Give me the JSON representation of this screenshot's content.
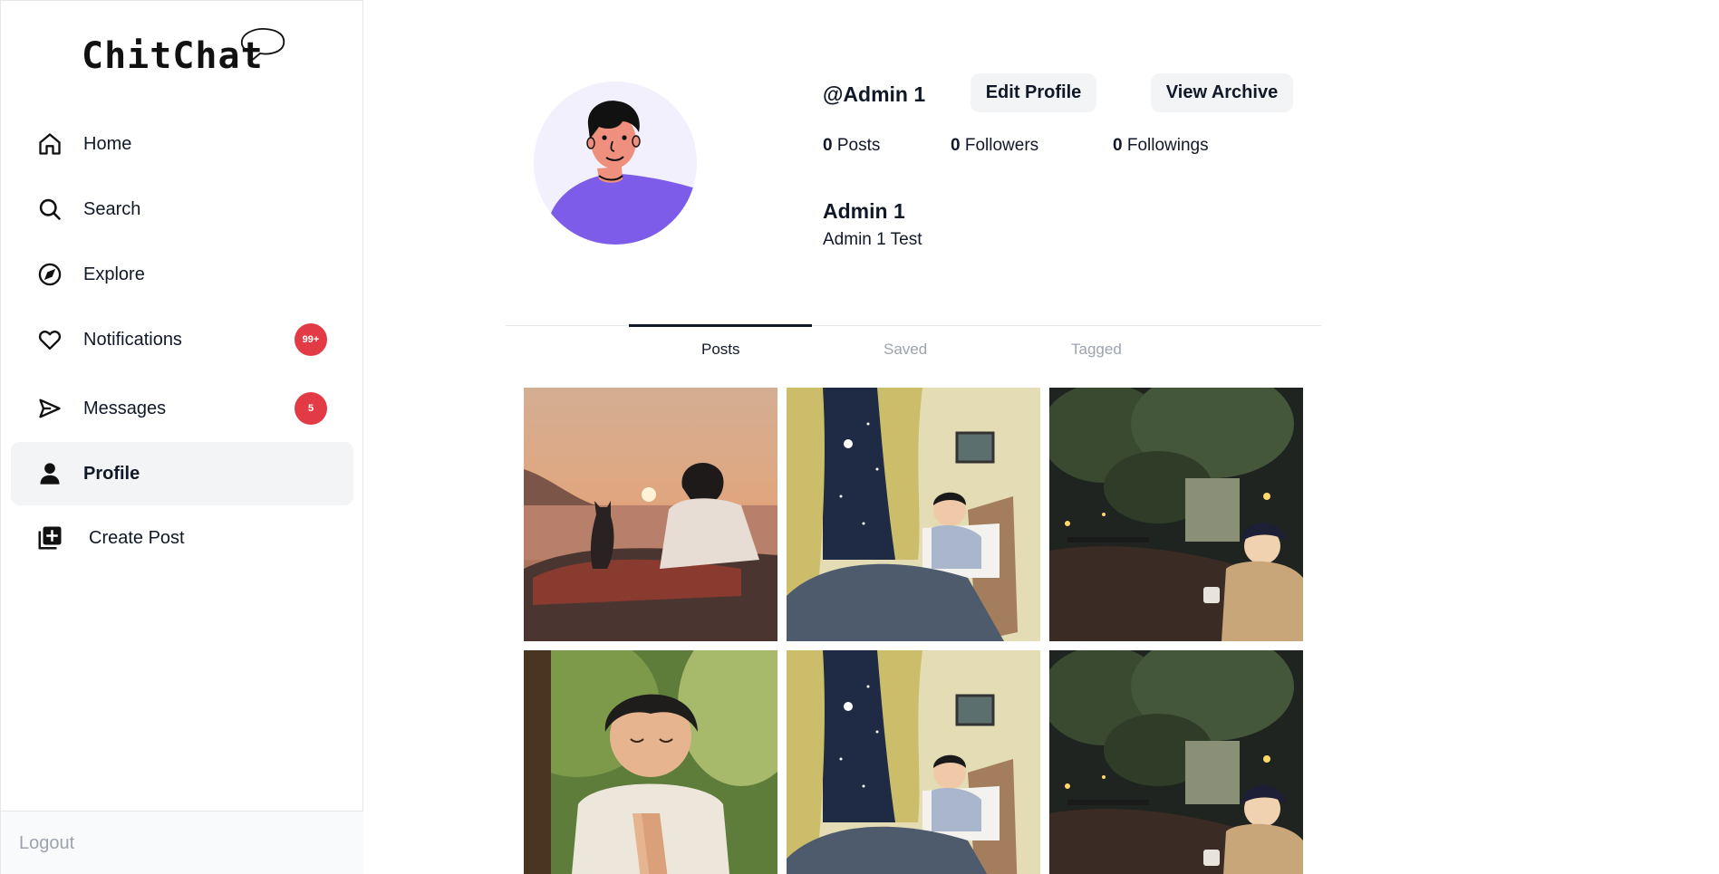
{
  "app": {
    "name": "ChitChat"
  },
  "sidebar": {
    "items": [
      {
        "label": "Home",
        "icon": "home-icon"
      },
      {
        "label": "Search",
        "icon": "search-icon"
      },
      {
        "label": "Explore",
        "icon": "compass-icon"
      },
      {
        "label": "Notifications",
        "icon": "heart-icon",
        "badge": "99+"
      },
      {
        "label": "Messages",
        "icon": "send-icon",
        "badge": "5"
      },
      {
        "label": "Profile",
        "icon": "user-icon",
        "active": true
      },
      {
        "label": "Create Post",
        "icon": "add-square-icon"
      }
    ],
    "logout_label": "Logout"
  },
  "profile": {
    "username": "@Admin 1",
    "edit_label": "Edit Profile",
    "archive_label": "View Archive",
    "stats": {
      "posts_count": "0",
      "posts_label": "Posts",
      "followers_count": "0",
      "followers_label": "Followers",
      "followings_count": "0",
      "followings_label": "Followings"
    },
    "full_name": "Admin 1",
    "bio": "Admin 1 Test"
  },
  "tabs": [
    {
      "label": "Posts",
      "active": true
    },
    {
      "label": "Saved",
      "active": false
    },
    {
      "label": "Tagged",
      "active": false
    }
  ],
  "colors": {
    "badge": "#e23b45",
    "avatar_shirt": "#7c5ce8",
    "avatar_bg": "#f3f0fd",
    "active_nav_bg": "#f3f4f6"
  }
}
